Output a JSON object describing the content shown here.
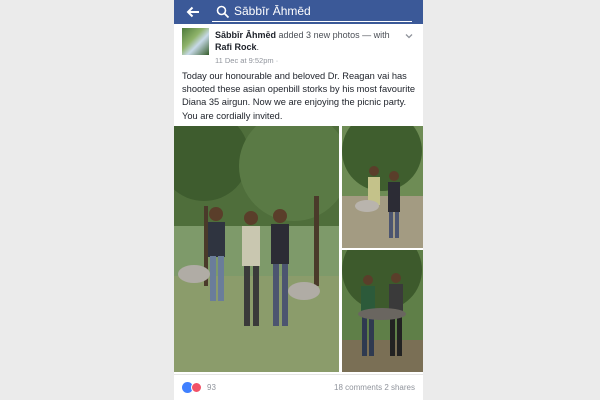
{
  "search": {
    "value": "Sābbīr Āhmēd"
  },
  "post": {
    "author": "Sābbīr Āhmēd",
    "action": "added 3 new photos —",
    "with_prefix": "with",
    "tagged": "Rafi Rock",
    "timestamp": "11 Dec at 9:52pm",
    "privacy_separator": "·",
    "text": "Today our honourable and beloved Dr. Reagan vai has shooted these asian openbill storks by his most favourite Diana 35 airgun. Now we are enjoying the picnic party. You are cordially invited."
  },
  "footer": {
    "reactions": "93",
    "comments": "18 comments",
    "shares": "2 shares"
  },
  "colors": {
    "brand": "#3b5998",
    "like": "#4080ff",
    "love": "#f25268"
  },
  "icons": [
    "back-arrow-icon",
    "search-icon",
    "chevron-down-icon",
    "like-reaction-icon",
    "love-reaction-icon"
  ]
}
